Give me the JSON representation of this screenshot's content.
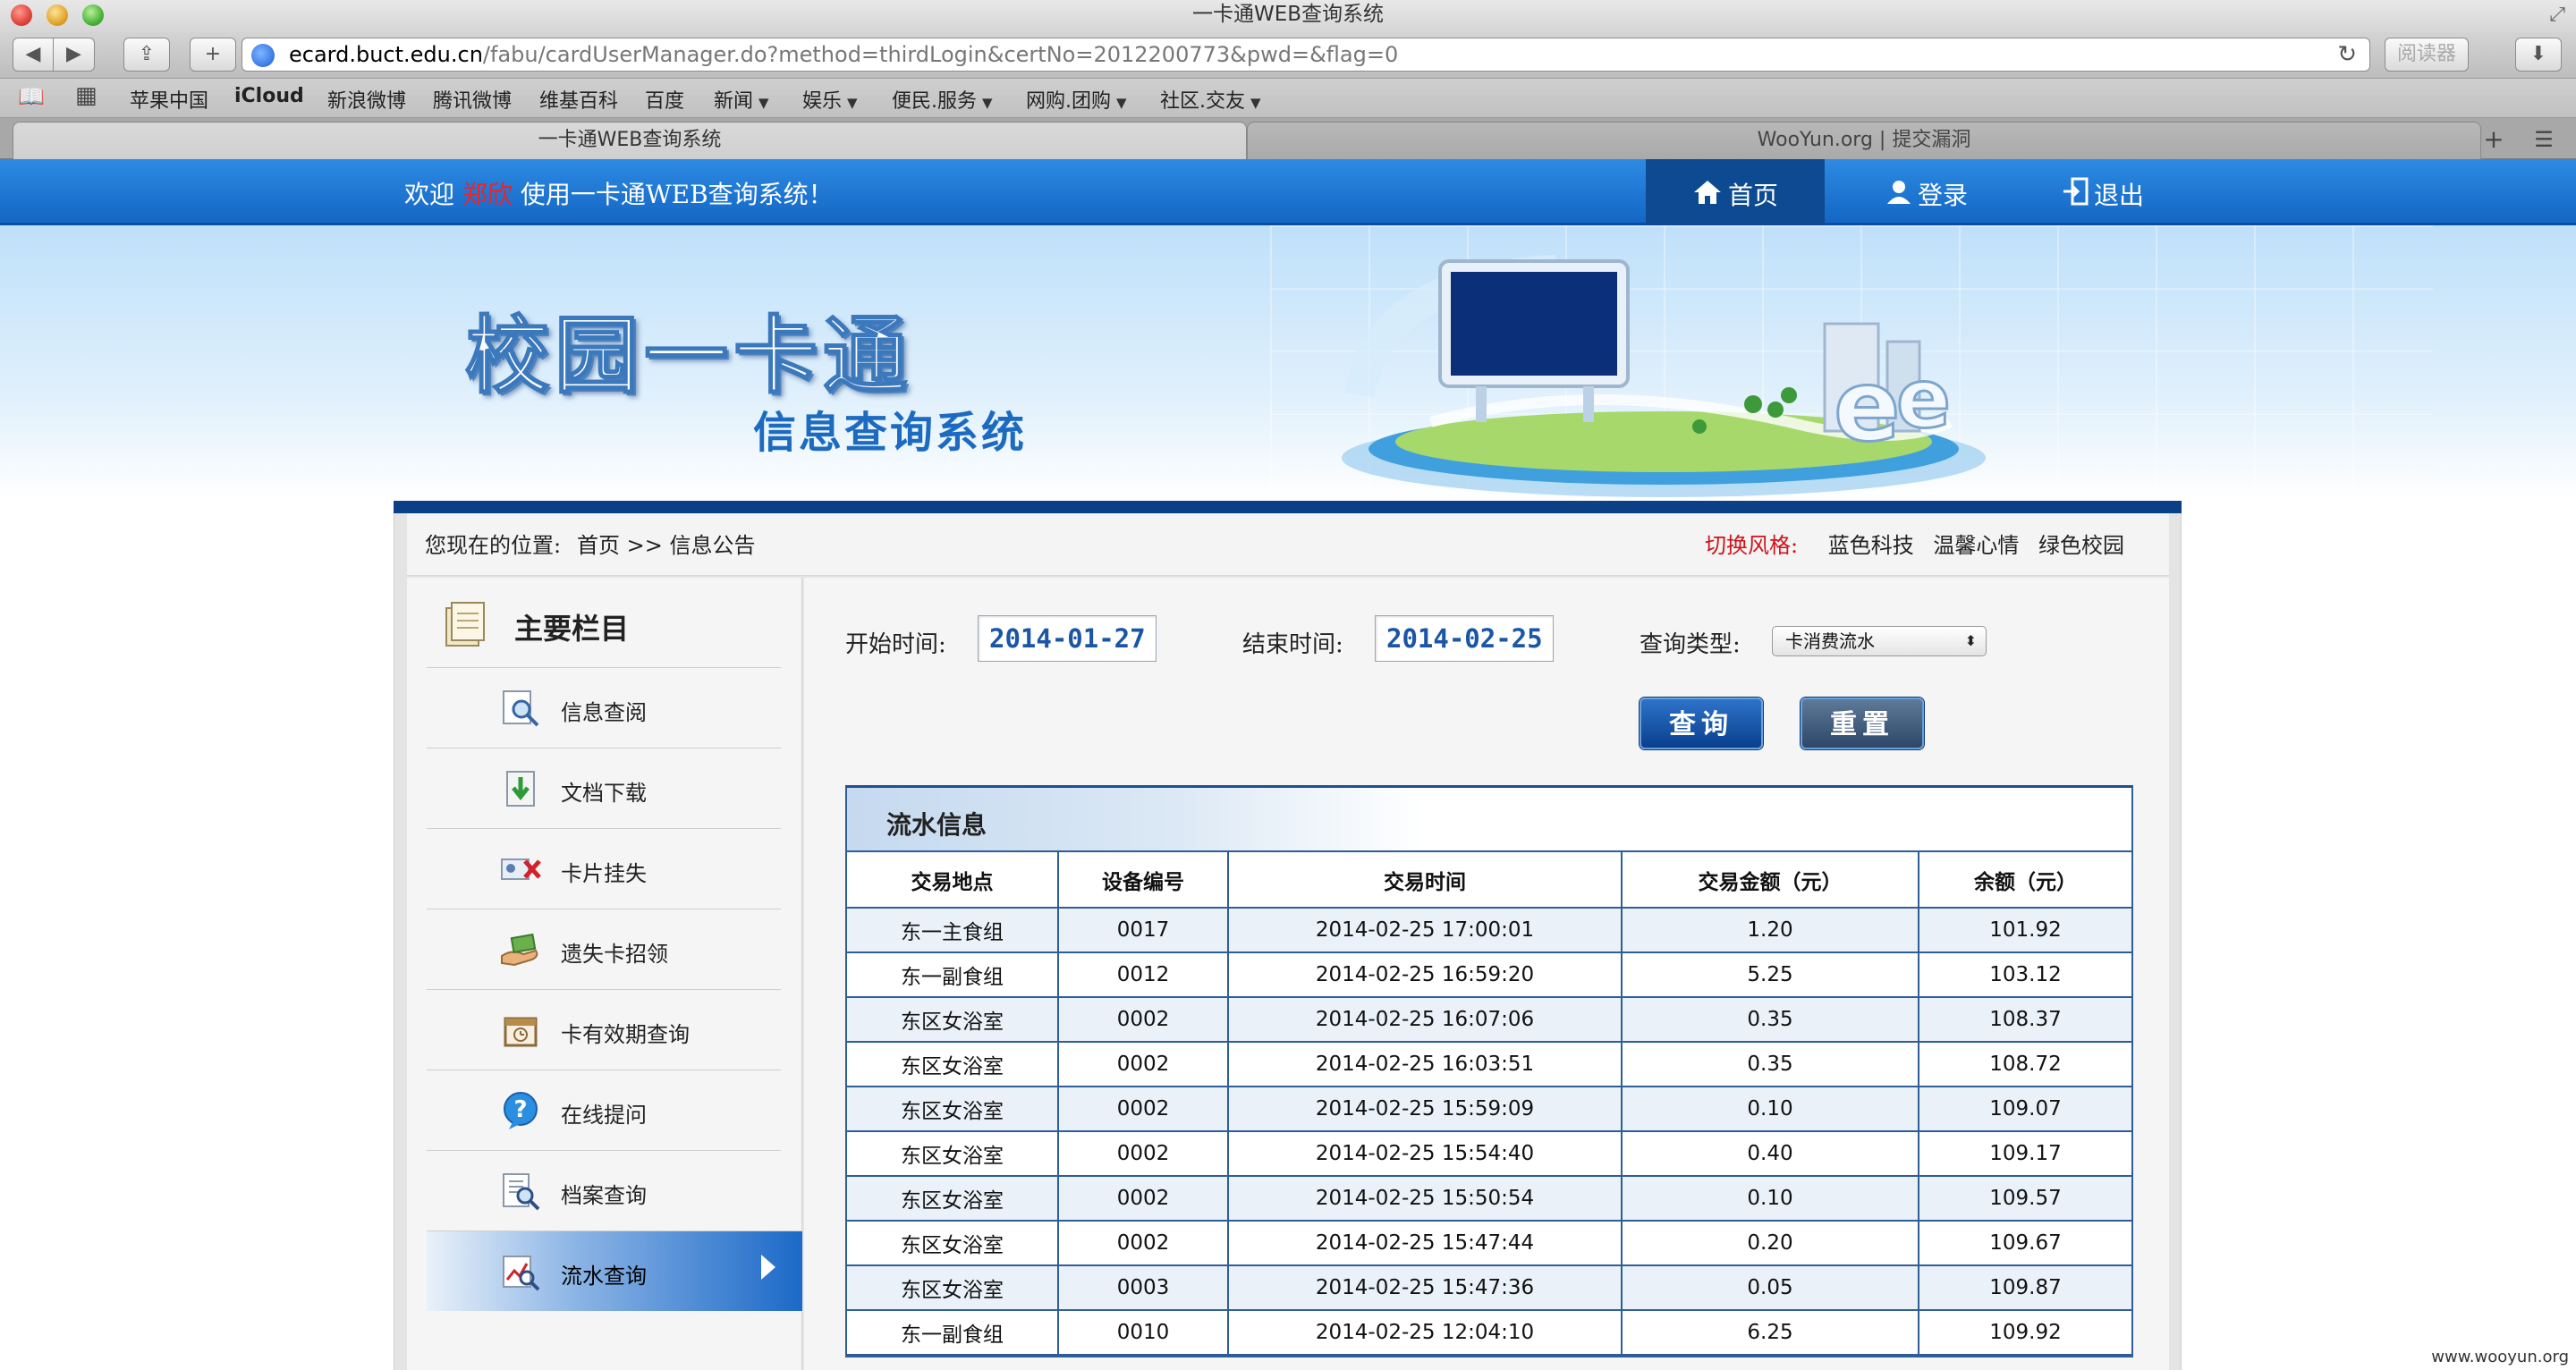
{
  "browser": {
    "window_title": "一卡通WEB查询系统",
    "url_host": "ecard.buct.edu.cn",
    "url_path": "/fabu/cardUserManager.do?method=thirdLogin&certNo=2012200773&pwd=&flag=0",
    "reader_label": "阅读器",
    "bookmarks": [
      "苹果中国",
      "iCloud",
      "新浪微博",
      "腾讯微博",
      "维基百科",
      "百度",
      "新闻",
      "娱乐",
      "便民.服务",
      "网购.团购",
      "社区.交友"
    ],
    "tabs": [
      "一卡通WEB查询系统",
      "WooYun.org | 提交漏洞"
    ]
  },
  "topnav": {
    "welcome_prefix": "欢迎",
    "user_name": "郑欣",
    "welcome_suffix": "使用一卡通WEB查询系统！",
    "home": "首页",
    "login": "登录",
    "logout": "退出"
  },
  "banner": {
    "title": "校园一卡通",
    "subtitle": "信息查询系统"
  },
  "breadcrumb": {
    "label": "您现在的位置:",
    "path": "首页 >> 信息公告",
    "style_label": "切换风格:",
    "styles": [
      "蓝色科技",
      "温馨心情",
      "绿色校园"
    ]
  },
  "sidebar": {
    "title": "主要栏目",
    "items": [
      {
        "label": "信息查阅",
        "icon": "search-doc-icon"
      },
      {
        "label": "文档下载",
        "icon": "download-doc-icon"
      },
      {
        "label": "卡片挂失",
        "icon": "card-cancel-icon"
      },
      {
        "label": "遗失卡招领",
        "icon": "hand-card-icon"
      },
      {
        "label": "卡有效期查询",
        "icon": "calendar-icon"
      },
      {
        "label": "在线提问",
        "icon": "question-icon"
      },
      {
        "label": "档案查询",
        "icon": "file-search-icon"
      },
      {
        "label": "流水查询",
        "icon": "chart-search-icon"
      }
    ],
    "active_index": 7
  },
  "query": {
    "start_label": "开始时间:",
    "start_value": "2014-01-27",
    "end_label": "结束时间:",
    "end_value": "2014-02-25",
    "type_label": "查询类型:",
    "type_value": "卡消费流水",
    "query_button": "查询",
    "reset_button": "重置"
  },
  "table": {
    "title": "流水信息",
    "columns": [
      "交易地点",
      "设备编号",
      "交易时间",
      "交易金额（元）",
      "余额（元）"
    ],
    "rows": [
      [
        "东一主食组",
        "0017",
        "2014-02-25 17:00:01",
        "1.20",
        "101.92"
      ],
      [
        "东一副食组",
        "0012",
        "2014-02-25 16:59:20",
        "5.25",
        "103.12"
      ],
      [
        "东区女浴室",
        "0002",
        "2014-02-25 16:07:06",
        "0.35",
        "108.37"
      ],
      [
        "东区女浴室",
        "0002",
        "2014-02-25 16:03:51",
        "0.35",
        "108.72"
      ],
      [
        "东区女浴室",
        "0002",
        "2014-02-25 15:59:09",
        "0.10",
        "109.07"
      ],
      [
        "东区女浴室",
        "0002",
        "2014-02-25 15:54:40",
        "0.40",
        "109.17"
      ],
      [
        "东区女浴室",
        "0002",
        "2014-02-25 15:50:54",
        "0.10",
        "109.57"
      ],
      [
        "东区女浴室",
        "0002",
        "2014-02-25 15:47:44",
        "0.20",
        "109.67"
      ],
      [
        "东区女浴室",
        "0003",
        "2014-02-25 15:47:36",
        "0.05",
        "109.87"
      ],
      [
        "东一副食组",
        "0010",
        "2014-02-25 12:04:10",
        "6.25",
        "109.92"
      ]
    ]
  },
  "watermark": "www.wooyun.org",
  "colors": {
    "nav_blue": "#1466c5",
    "nav_active": "#0d4a92",
    "username_red": "#e8242c",
    "table_border": "#2d5e98"
  }
}
